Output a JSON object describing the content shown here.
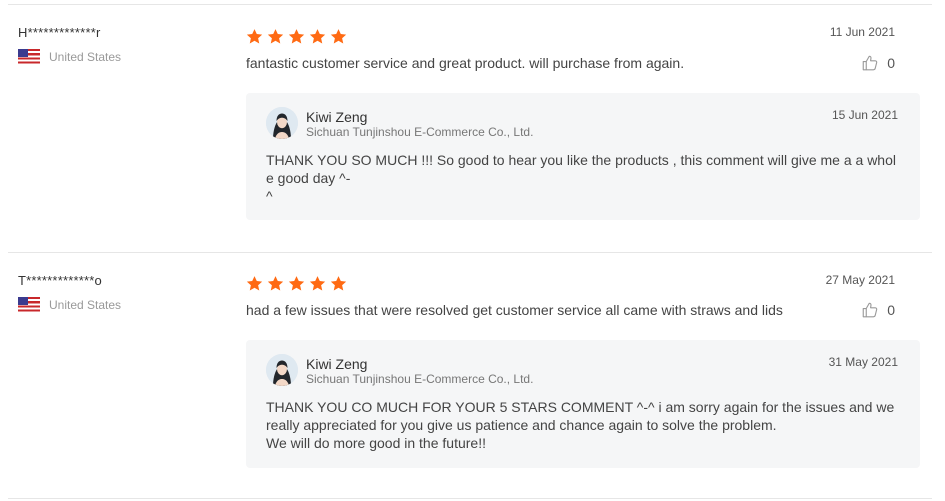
{
  "reviews": [
    {
      "buyer": "H*************r",
      "country": "United States",
      "stars": 5,
      "date": "11 Jun 2021",
      "text": "fantastic customer service and great product. will purchase from again.",
      "helpful_count": "0",
      "reply": {
        "seller_name": "Kiwi Zeng",
        "company": "Sichuan Tunjinshou E-Commerce Co., Ltd.",
        "date": "15 Jun 2021",
        "text": "THANK YOU SO MUCH !!! So good to hear you like the products , this comment  will give me a a whole good day ^-\n^"
      }
    },
    {
      "buyer": "T*************o",
      "country": "United States",
      "stars": 5,
      "date": "27 May 2021",
      "text": "had a few issues that were resolved get customer service all came with straws and lids",
      "helpful_count": "0",
      "reply": {
        "seller_name": "Kiwi Zeng",
        "company": "Sichuan Tunjinshou E-Commerce Co., Ltd.",
        "date": "31 May 2021",
        "text": "THANK YOU CO MUCH FOR YOUR 5 STARS COMMENT ^-^  i am sorry again for the issues and we really appreciated for you give us patience and chance again to solve the problem.\nWe will do more good in the future!!"
      }
    }
  ],
  "colors": {
    "star": "#ff6a13",
    "reply_bg": "#f5f6f7",
    "divider": "#e6e6e6"
  },
  "icons": {
    "rating": "star-icon",
    "helpful": "thumbs-up-icon",
    "country": "us-flag-icon"
  }
}
